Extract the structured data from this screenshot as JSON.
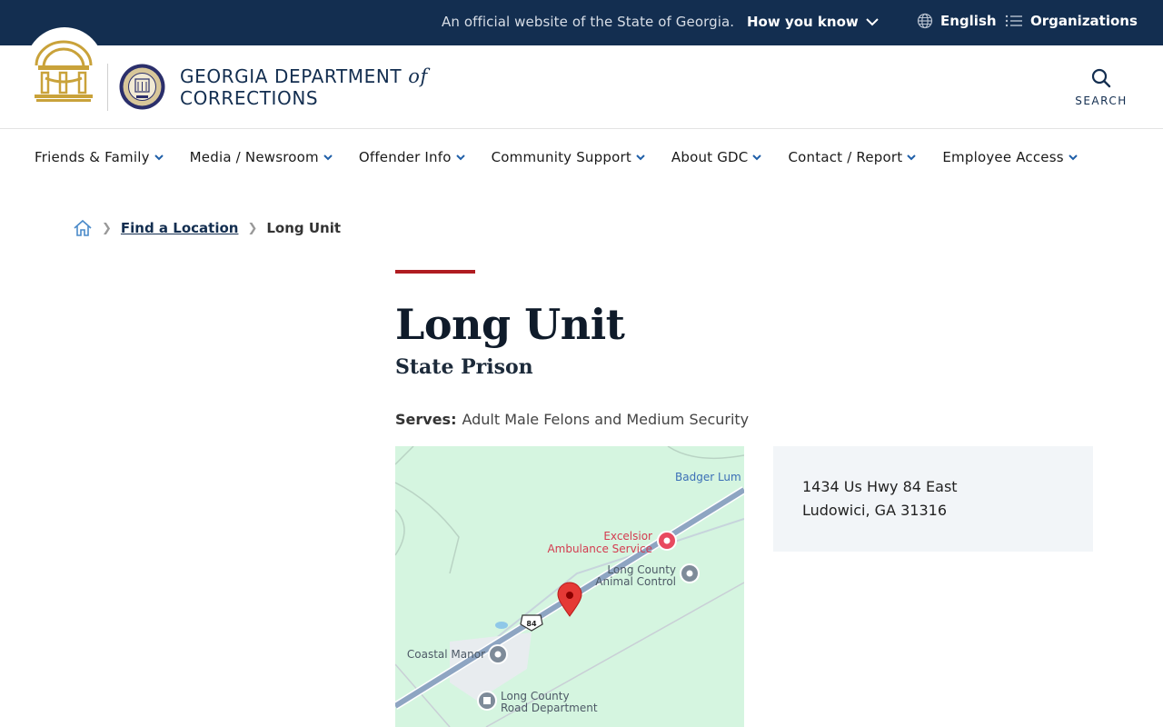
{
  "topbar": {
    "official_text": "An official website of the State of Georgia.",
    "how_you_know": "How you know",
    "language": "English",
    "organizations": "Organizations"
  },
  "header": {
    "agency_line1": "GEORGIA DEPARTMENT",
    "agency_of": "of",
    "agency_line2": "CORRECTIONS",
    "search_label": "SEARCH"
  },
  "nav": {
    "items": [
      {
        "label": "Friends & Family"
      },
      {
        "label": "Media / Newsroom"
      },
      {
        "label": "Offender Info"
      },
      {
        "label": "Community Support"
      },
      {
        "label": "About GDC"
      },
      {
        "label": "Contact / Report"
      },
      {
        "label": "Employee Access"
      }
    ]
  },
  "breadcrumb": {
    "link": "Find a Location",
    "current": "Long Unit"
  },
  "main": {
    "title": "Long Unit",
    "subtitle": "State Prison",
    "serves_label": "Serves:",
    "serves_value": "Adult Male Felons and Medium Security"
  },
  "map": {
    "labels": {
      "badger": "Badger Lum",
      "excelsior_1": "Excelsior",
      "excelsior_2": "Ambulance Service",
      "animal_1": "Long County",
      "animal_2": "Animal Control",
      "coastal": "Coastal Manor",
      "road_1": "Long County",
      "road_2": "Road Department",
      "shield": "84"
    }
  },
  "address": {
    "line1": "1434 Us Hwy 84 East",
    "line2": "Ludowici, GA 31316"
  },
  "colors": {
    "navy": "#132e50",
    "accent_red": "#b01c21",
    "map_green": "#d5f5e0"
  }
}
